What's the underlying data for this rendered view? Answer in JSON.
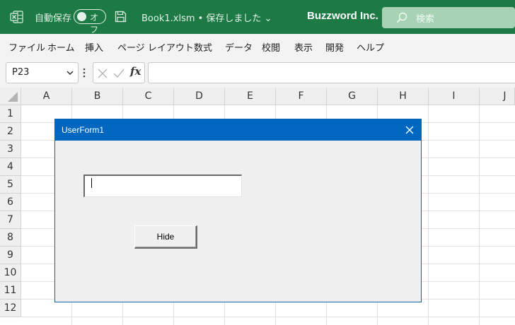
{
  "titlebar": {
    "autosave_label": "自動保存",
    "autosave_toggle": "オフ",
    "filename": "Book1.xlsm • 保存しました ⌄",
    "company": "Buzzword Inc.",
    "search_placeholder": "検索"
  },
  "menu": {
    "items": [
      "ファイル",
      "ホーム",
      "挿入",
      "ページ レイアウト",
      "数式",
      "データ",
      "校閲",
      "表示",
      "開発",
      "ヘルプ"
    ]
  },
  "formula_bar": {
    "name_box": "P23",
    "formula": ""
  },
  "grid": {
    "columns": [
      "A",
      "B",
      "C",
      "D",
      "E",
      "F",
      "G",
      "H",
      "I",
      "J"
    ],
    "rows": [
      "1",
      "2",
      "3",
      "4",
      "5",
      "6",
      "7",
      "8",
      "9",
      "10",
      "11",
      "12"
    ]
  },
  "userform": {
    "title": "UserForm1",
    "textbox_value": "",
    "button_label": "Hide"
  },
  "colors": {
    "excel_green": "#1d7a45",
    "form_title_blue": "#0067c0",
    "form_background": "#f0f0f0"
  }
}
